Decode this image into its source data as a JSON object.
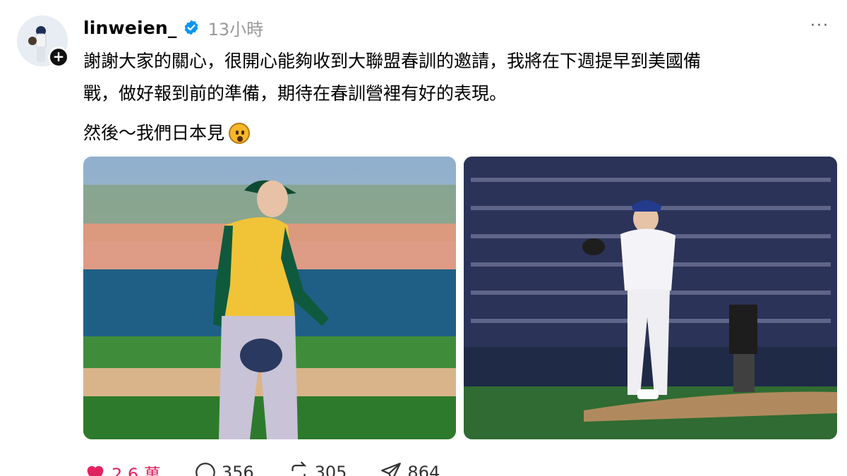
{
  "post": {
    "username": "linweien_",
    "time": "13小時",
    "more_label": "···",
    "follow_label": "+",
    "text": "謝謝大家的關心，很開心能夠收到大聯盟春訓的邀請，我將在下週提早到美國備\n戰，做好報到前的準備，期待在春訓營裡有好的表現。",
    "text2": "然後～我們日本見"
  },
  "photos": [
    {
      "icon": "pitcher-athletics-photo"
    },
    {
      "icon": "pitcher-taiwan-stadium-photo"
    }
  ],
  "actions": {
    "likes": "2.6 萬",
    "comments": "356",
    "reposts": "305",
    "shares": "864"
  },
  "colors": {
    "like": "#e0245e",
    "verified": "#0095f6",
    "muted": "#999999"
  }
}
